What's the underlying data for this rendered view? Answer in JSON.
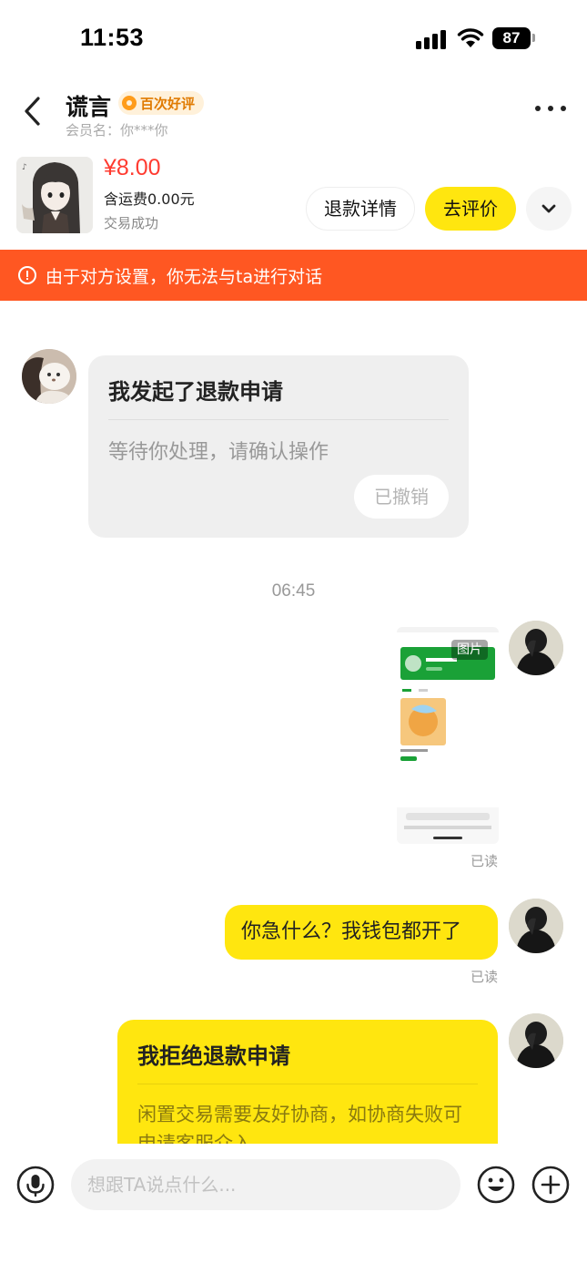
{
  "status_bar": {
    "time": "11:53",
    "battery": "87"
  },
  "header": {
    "contact_name": "谎言",
    "badge": "百次好评",
    "member_label": "会员名：你***你",
    "back_icon": "chevron-left-icon",
    "more_icon": "more-horizontal-icon"
  },
  "product": {
    "price": "¥8.00",
    "shipping": "含运费0.00元",
    "status": "交易成功",
    "refund_detail_label": "退款详情",
    "review_label": "去评价",
    "expand_icon": "chevron-down-icon"
  },
  "warning": {
    "text": "由于对方设置，你无法与ta进行对话",
    "icon": "alert-circle-icon"
  },
  "messages": {
    "refund_request": {
      "title": "我发起了退款申请",
      "desc": "等待你处理，请确认操作",
      "status": "已撤销"
    },
    "time_label": "06:45",
    "image_tag": "图片",
    "read_label_1": "已读",
    "text_message": "你急什么？我钱包都开了",
    "read_label_2": "已读",
    "refund_reject": {
      "title": "我拒绝退款申请",
      "desc": "闲置交易需要友好协商，如协商失败可申请客服介入"
    }
  },
  "input_bar": {
    "placeholder": "想跟TA说点什么...",
    "mic_icon": "microphone-icon",
    "emoji_icon": "emoji-icon",
    "plus_icon": "plus-circle-icon"
  },
  "colors": {
    "accent_yellow": "#ffe60f",
    "warning_orange": "#ff5722",
    "price_red": "#ff3b30"
  }
}
